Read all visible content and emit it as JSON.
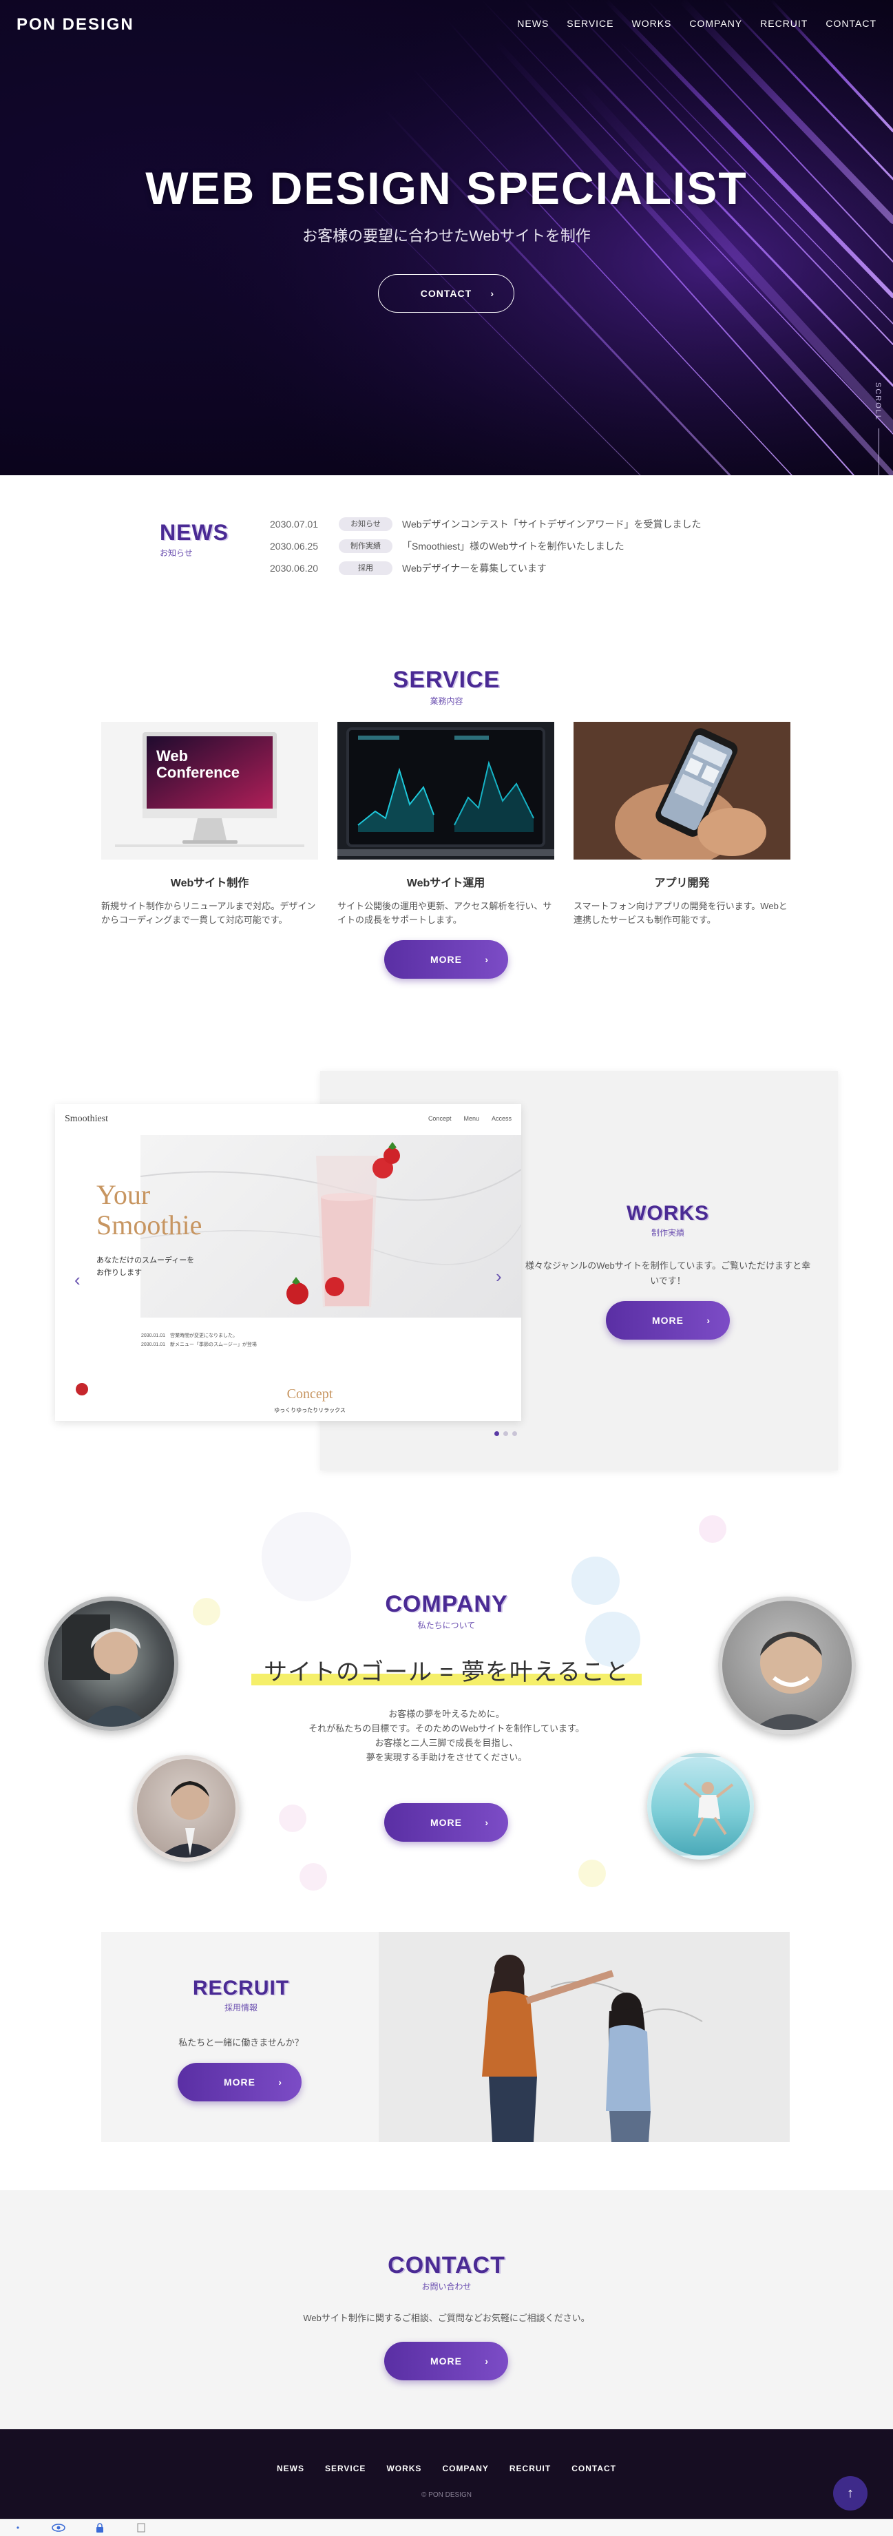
{
  "header": {
    "logo": "PON DESIGN",
    "nav": [
      "NEWS",
      "SERVICE",
      "WORKS",
      "COMPANY",
      "RECRUIT",
      "CONTACT"
    ]
  },
  "hero": {
    "title": "WEB DESIGN SPECIALIST",
    "subtitle": "お客様の要望に合わせたWebサイトを制作",
    "button": "CONTACT",
    "scroll": "SCROLL"
  },
  "news": {
    "title": "NEWS",
    "subtitle": "お知らせ",
    "items": [
      {
        "date": "2030.07.01",
        "category": "お知らせ",
        "text": "Webデザインコンテスト「サイトデザインアワード」を受賞しました"
      },
      {
        "date": "2030.06.25",
        "category": "制作実績",
        "text": "「Smoothiest」様のWebサイトを制作いたしました"
      },
      {
        "date": "2030.06.20",
        "category": "採用",
        "text": "Webデザイナーを募集しています"
      }
    ]
  },
  "service": {
    "title": "SERVICE",
    "subtitle": "業務内容",
    "cards": [
      {
        "name": "Webサイト制作",
        "desc": "新規サイト制作からリニューアルまで対応。デザインからコーディングまで一貫して対応可能です。",
        "img_text_1": "Web",
        "img_text_2": "Conference"
      },
      {
        "name": "Webサイト運用",
        "desc": "サイト公開後の運用や更新、アクセス解析を行い、サイトの成長をサポートします。"
      },
      {
        "name": "アプリ開発",
        "desc": "スマートフォン向けアプリの開発を行います。Webと連携したサービスも制作可能です。"
      }
    ],
    "button": "MORE"
  },
  "works": {
    "title": "WORKS",
    "subtitle": "制作実績",
    "desc": "様々なジャンルのWebサイトを制作しています。ご覧いただけますと幸いです！",
    "button": "MORE",
    "slide": {
      "brand": "Smoothiest",
      "nav": [
        "Concept",
        "Menu",
        "Access"
      ],
      "headline_1": "Your",
      "headline_2": "Smoothie",
      "copy_1": "あなただけのスムーディーを",
      "copy_2": "お作りします",
      "news_1": "2030.01.01　営業時間が変更になりました。",
      "news_2": "2030.01.01　新メニュー「季節のスムージー」が登場",
      "concept": "Concept",
      "concept_sub": "ゆっくりゆったりリラックス",
      "prev": "‹",
      "next": "›"
    }
  },
  "company": {
    "title": "COMPANY",
    "subtitle": "私たちについて",
    "catch": "サイトのゴール = 夢を叶えること",
    "text_1": "お客様の夢を叶えるために。",
    "text_2": "それが私たちの目標です。そのためのWebサイトを制作しています。",
    "text_3": "お客様と二人三脚で成長を目指し、",
    "text_4": "夢を実現する手助けをさせてください。",
    "button": "MORE"
  },
  "recruit": {
    "title": "RECRUIT",
    "subtitle": "採用情報",
    "text": "私たちと一緒に働きませんか？",
    "button": "MORE"
  },
  "contact": {
    "title": "CONTACT",
    "subtitle": "お問い合わせ",
    "text": "Webサイト制作に関するご相談、ご質問などお気軽にご相談ください。",
    "button": "MORE"
  },
  "footer": {
    "nav": [
      "NEWS",
      "SERVICE",
      "WORKS",
      "COMPANY",
      "RECRUIT",
      "CONTACT"
    ],
    "copyright": "© PON DESIGN",
    "to_top": "↑"
  },
  "colors": {
    "accent": "#5a2fa4",
    "heading": "#4a2a94",
    "hero_bg": "#0d0522",
    "footer_bg": "#160d22",
    "highlight": "#f5ef6a"
  }
}
